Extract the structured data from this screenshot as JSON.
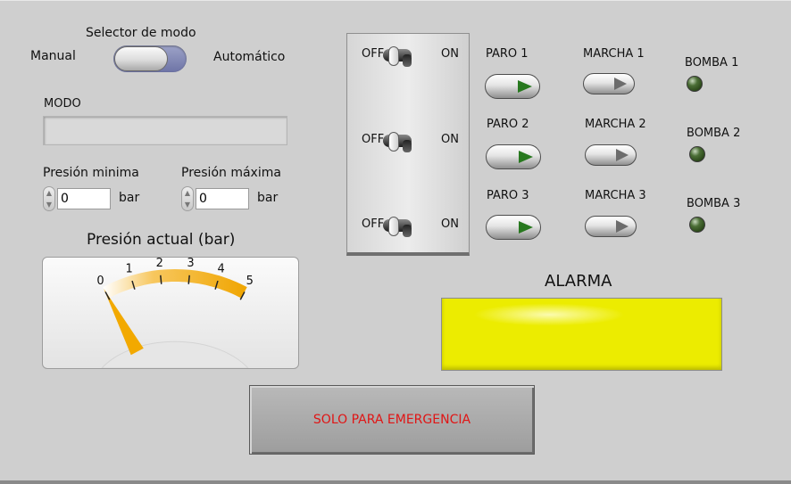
{
  "mode_selector": {
    "title": "Selector de modo",
    "left_label": "Manual",
    "right_label": "Automático"
  },
  "mode": {
    "label": "MODO",
    "value": ""
  },
  "pressure_min": {
    "label": "Presión minima",
    "value": "0",
    "unit": "bar"
  },
  "pressure_max": {
    "label": "Presión máxima",
    "value": "0",
    "unit": "bar"
  },
  "gauge": {
    "title": "Presión actual (bar)",
    "ticks": [
      "0",
      "1",
      "2",
      "3",
      "4",
      "5"
    ],
    "min": 0,
    "max": 5,
    "value": 0,
    "colors": {
      "arc_low": "#ffffff",
      "arc_high": "#f2a900"
    }
  },
  "switches": {
    "off_label": "OFF",
    "on_label": "ON",
    "items": [
      {
        "state": "off"
      },
      {
        "state": "off"
      },
      {
        "state": "off"
      }
    ]
  },
  "paro": [
    "PARO 1",
    "PARO 2",
    "PARO 3"
  ],
  "marcha": [
    "MARCHA 1",
    "MARCHA 2",
    "MARCHA 3"
  ],
  "bombas": [
    "BOMBA 1",
    "BOMBA 2",
    "BOMBA 3"
  ],
  "alarm": {
    "label": "ALARMA",
    "color": "#e8e800"
  },
  "emergency": {
    "label": "SOLO PARA EMERGENCIA",
    "color": "#e01515"
  }
}
